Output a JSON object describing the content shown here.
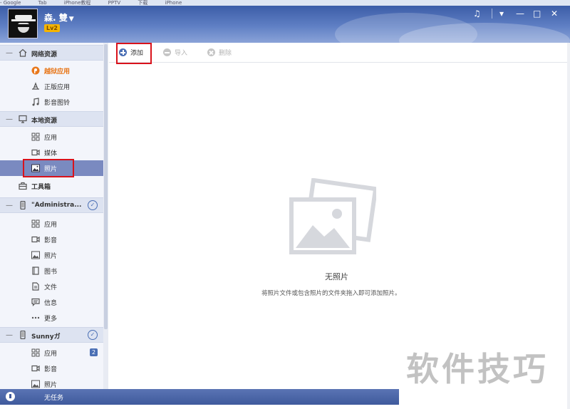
{
  "browser_tabs": [
    "- Google",
    "Tab",
    "iPhone教程",
    "PPTV",
    "下载",
    "iPhone"
  ],
  "header": {
    "username": "森. 雙",
    "level": "Lv2",
    "controls": [
      "♫",
      "▾",
      "—",
      "□",
      "✕"
    ]
  },
  "sidebar": {
    "groups": {
      "network": {
        "label": "网络资源",
        "icon": "home-icon"
      },
      "local": {
        "label": "本地资源",
        "icon": "monitor-icon"
      },
      "toolbox": {
        "label": "工具箱",
        "icon": "toolbox-icon"
      },
      "device1": {
        "label": "\"Administra...",
        "icon": "phone-icon"
      },
      "device2": {
        "label": "Sunnyガ",
        "icon": "phone-icon"
      }
    },
    "network_items": [
      {
        "label": "越狱应用",
        "icon": "jailbreak-icon"
      },
      {
        "label": "正版应用",
        "icon": "appstore-icon"
      },
      {
        "label": "影音图铃",
        "icon": "music-note-icon"
      }
    ],
    "local_items": [
      {
        "label": "应用",
        "icon": "apps-grid-icon"
      },
      {
        "label": "媒体",
        "icon": "video-icon"
      },
      {
        "label": "照片",
        "icon": "photo-icon"
      }
    ],
    "device1_items": [
      {
        "label": "应用",
        "icon": "apps-grid-icon"
      },
      {
        "label": "影音",
        "icon": "video-icon"
      },
      {
        "label": "照片",
        "icon": "photo-icon"
      },
      {
        "label": "图书",
        "icon": "book-icon"
      },
      {
        "label": "文件",
        "icon": "file-icon"
      },
      {
        "label": "信息",
        "icon": "message-icon"
      },
      {
        "label": "更多",
        "icon": "more-icon"
      }
    ],
    "device2_items": [
      {
        "label": "应用",
        "icon": "apps-grid-icon",
        "badge": "2"
      },
      {
        "label": "影音",
        "icon": "video-icon"
      },
      {
        "label": "照片",
        "icon": "photo-icon"
      }
    ]
  },
  "status": {
    "text": "无任务"
  },
  "toolbar": {
    "add": "添加",
    "import": "导入",
    "delete": "删除"
  },
  "main": {
    "empty_title": "无照片",
    "empty_desc": "将照片文件或包含照片的文件夹拖入即可添加照片。"
  },
  "watermark": "软件技巧",
  "colors": {
    "header": "#4a6ab3",
    "selected": "#7a8ac0",
    "accent": "#4a6fb5",
    "highlight": "#e8781c",
    "annotation": "#d9121b"
  }
}
